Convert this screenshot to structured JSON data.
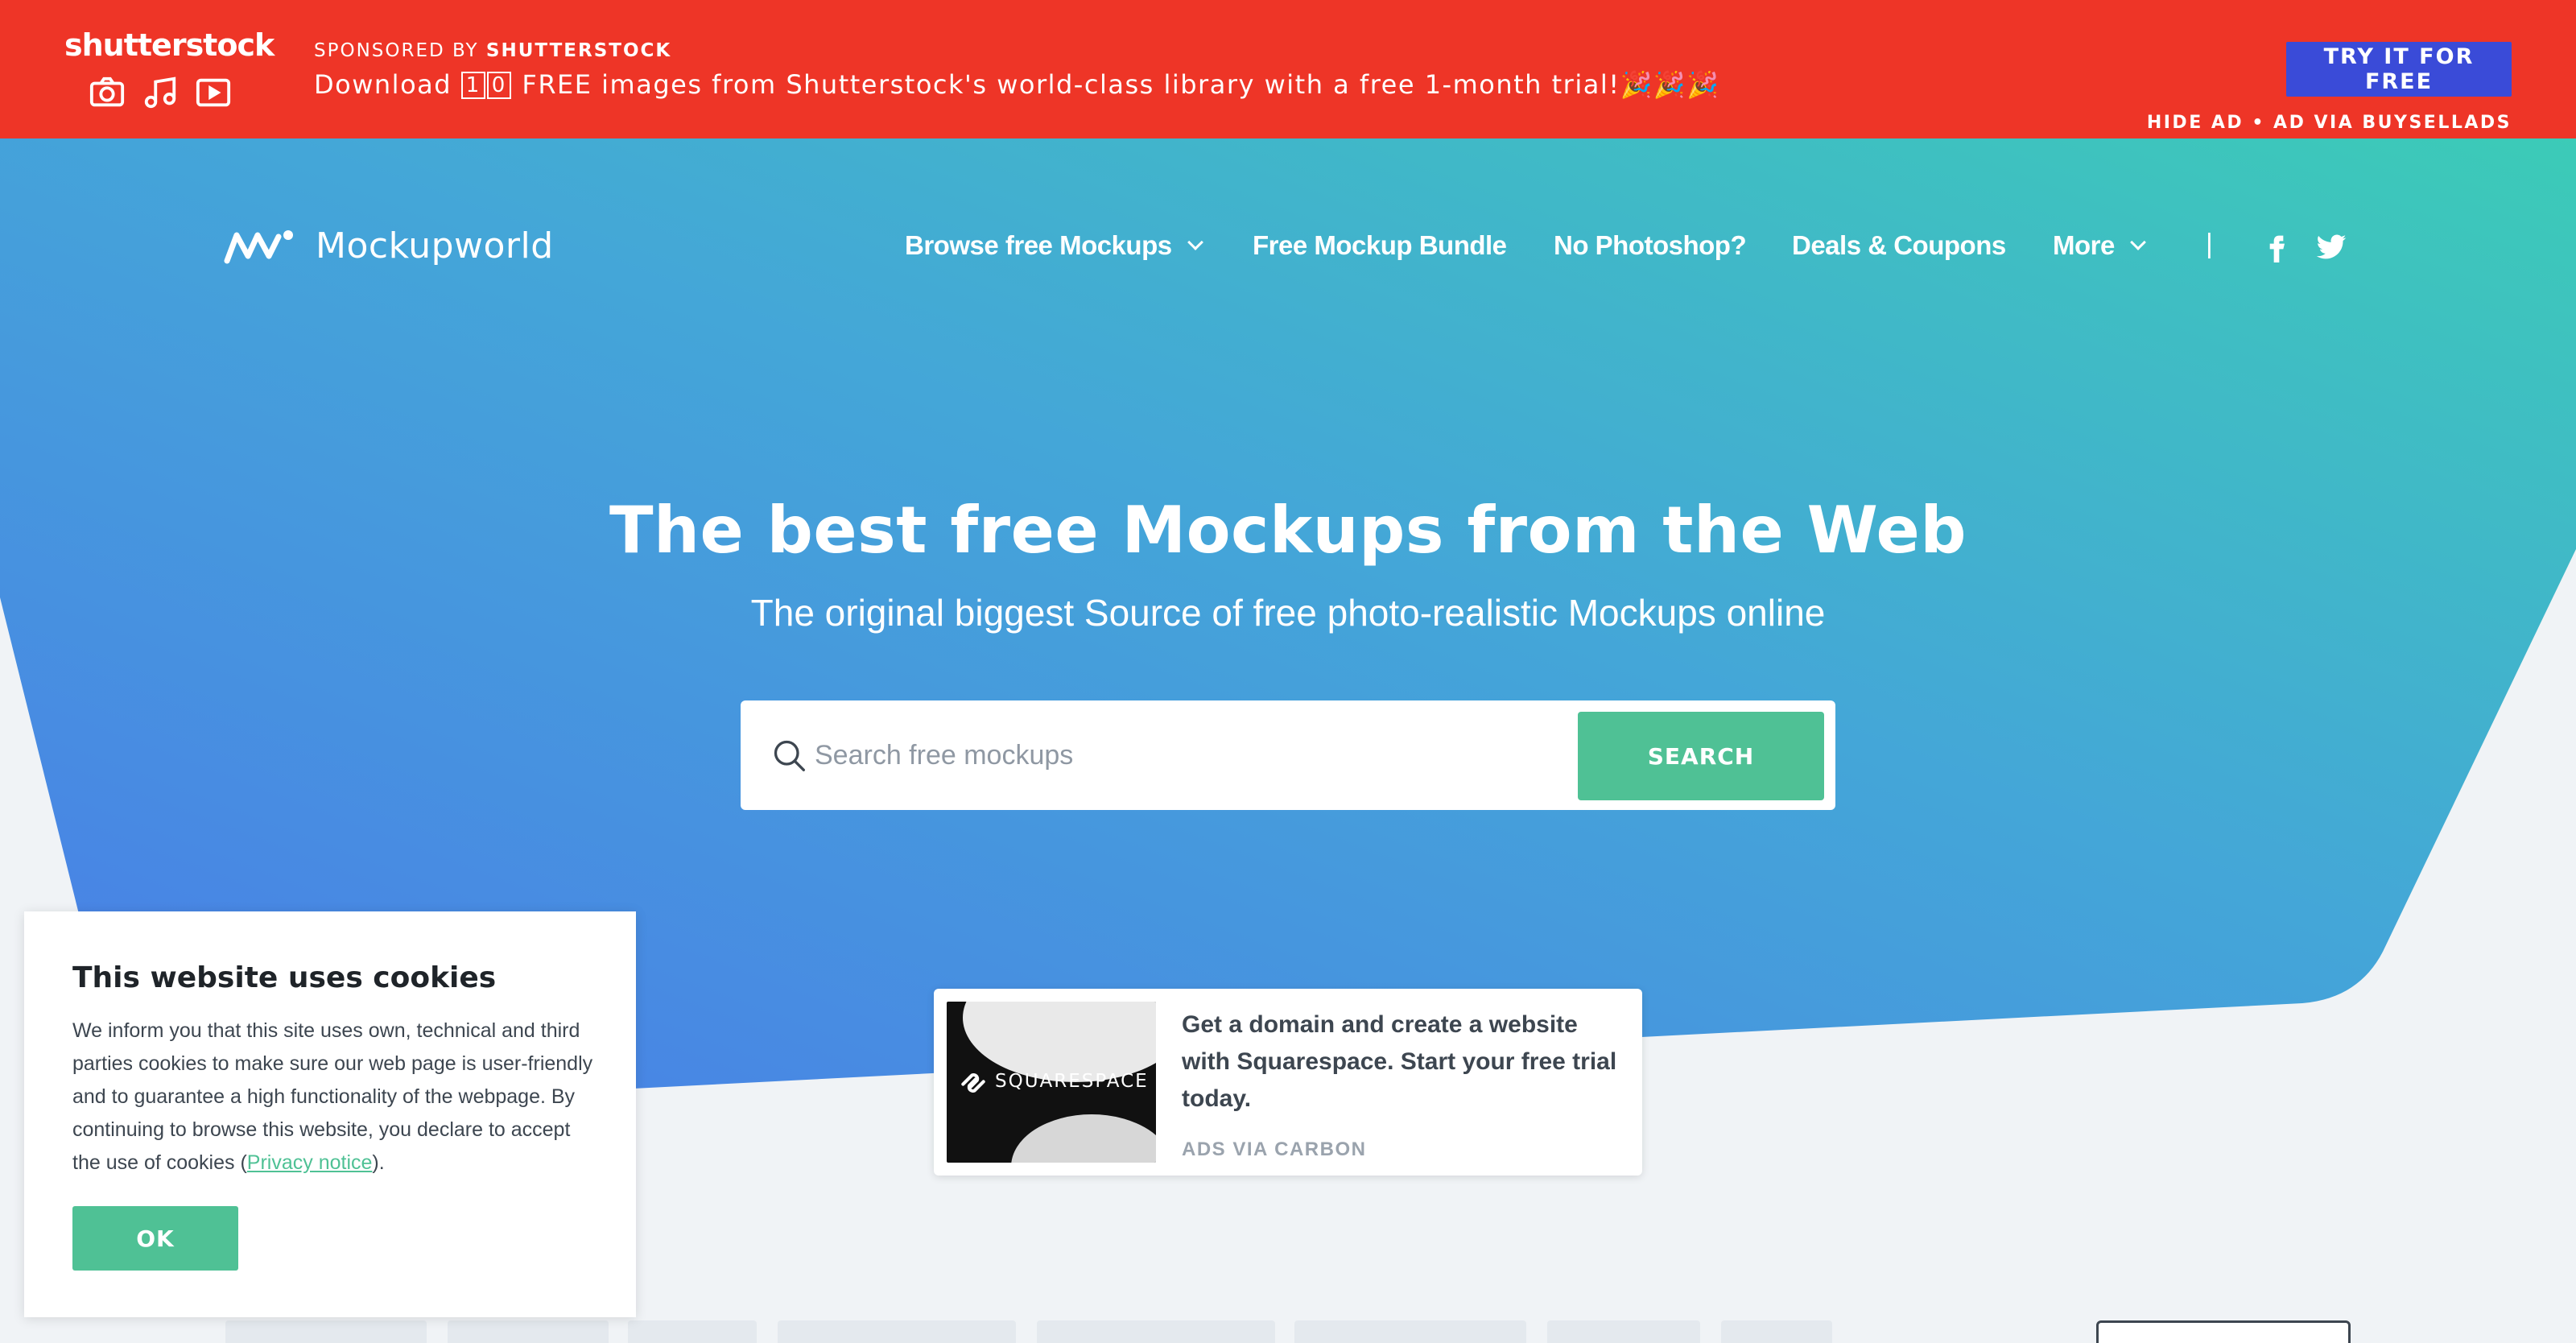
{
  "ad_bar": {
    "brand": "shutterstock",
    "sponsored_prefix": "SPONSORED BY",
    "sponsored_brand": "SHUTTERSTOCK",
    "text_before": "Download",
    "digit_1": "1",
    "digit_2": "0",
    "text_after": "FREE images from Shutterstock's world-class library with a free 1-month trial!",
    "party_emojis": "🎉🎉🎉",
    "cta_label": "TRY IT FOR FREE",
    "hide_label": "HIDE AD • AD VIA BUYSELLADS",
    "icons": [
      "camera-icon",
      "music-note-icon",
      "video-play-icon"
    ],
    "bg_color": "#ee3527",
    "cta_color": "#3a4bd8"
  },
  "nav": {
    "logo_text": "Mockupworld",
    "items": [
      {
        "label": "Browse free Mockups",
        "has_dropdown": true
      },
      {
        "label": "Free Mockup Bundle",
        "has_dropdown": false
      },
      {
        "label": "No Photoshop?",
        "has_dropdown": false
      },
      {
        "label": "Deals & Coupons",
        "has_dropdown": false
      },
      {
        "label": "More",
        "has_dropdown": true
      }
    ],
    "separator": "|",
    "social_icons": [
      "facebook-icon",
      "twitter-icon"
    ]
  },
  "hero": {
    "title": "The best free Mockups from the Web",
    "subtitle": "The original biggest Source of free photo-realistic Mockups online",
    "gradient_start": "#4a7ce8",
    "gradient_end": "#3ccbb7"
  },
  "search": {
    "placeholder": "Search free mockups",
    "button_label": "SEARCH",
    "button_color": "#4fc195"
  },
  "carbon_ad": {
    "image_brand": "SQUARESPACE",
    "text": "Get a domain and create a website with Squarespace. Start your free trial today.",
    "via": "ADS VIA CARBON"
  },
  "cookie": {
    "title": "This website uses cookies",
    "body_before_link": "We inform you that this site uses own, technical and third parties cookies to make sure our web page is user-friendly and to guarantee a high functionality of the webpage. By continuing to browse this website, you declare to accept the use of cookies (",
    "link_text": "Privacy notice",
    "body_after_link": ").",
    "ok_label": "OK"
  }
}
